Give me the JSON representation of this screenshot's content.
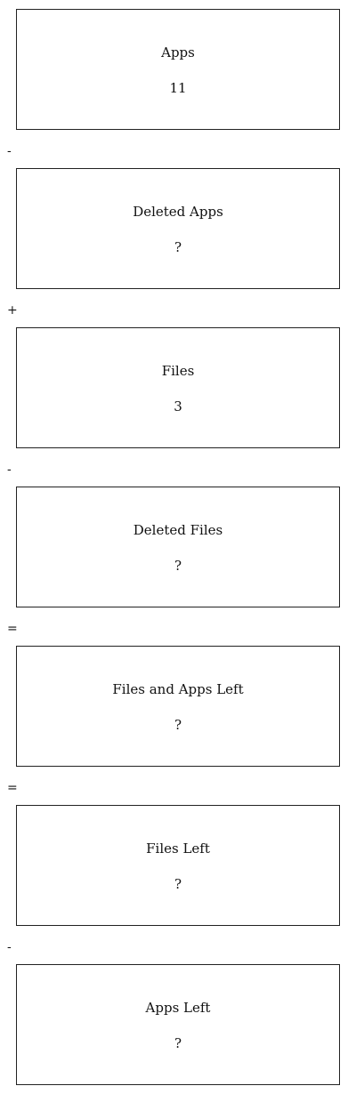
{
  "steps": [
    {
      "label": "Apps",
      "value": "11",
      "operator_after": "-"
    },
    {
      "label": "Deleted Apps",
      "value": "?",
      "operator_after": "+"
    },
    {
      "label": "Files",
      "value": "3",
      "operator_after": "-"
    },
    {
      "label": "Deleted Files",
      "value": "?",
      "operator_after": "="
    },
    {
      "label": "Files and Apps Left",
      "value": "?",
      "operator_after": "="
    },
    {
      "label": "Files Left",
      "value": "?",
      "operator_after": "-"
    },
    {
      "label": "Apps Left",
      "value": "?"
    }
  ]
}
